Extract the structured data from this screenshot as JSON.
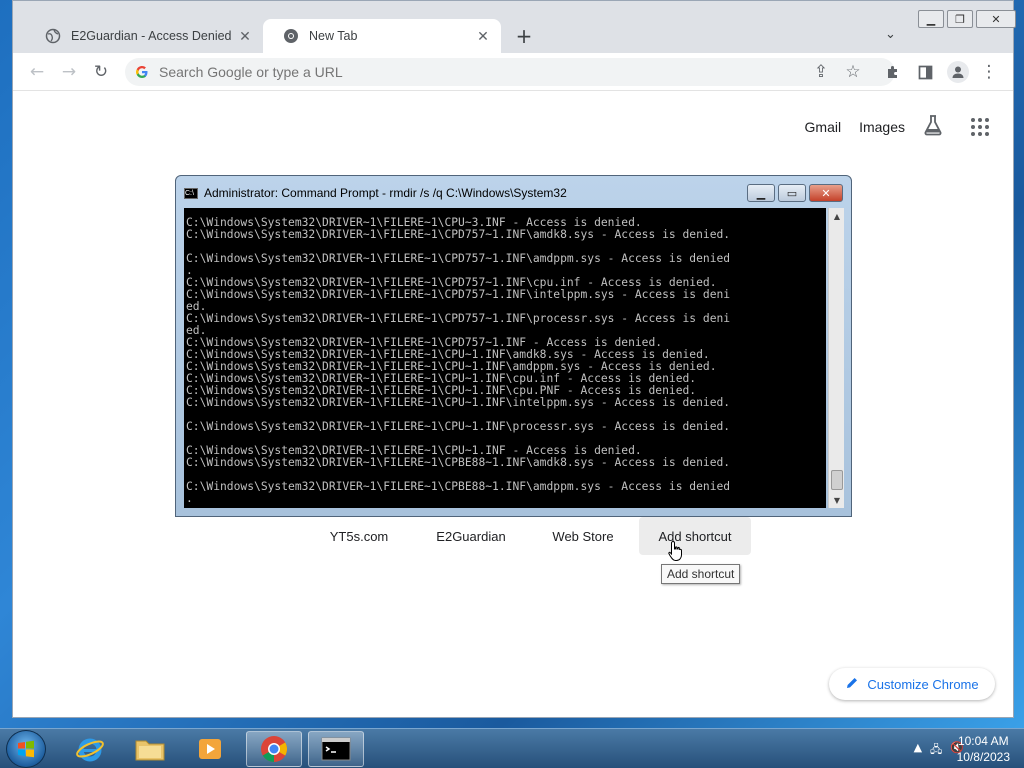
{
  "browser": {
    "tabs": [
      {
        "title": "E2Guardian - Access Denied",
        "active": false
      },
      {
        "title": "New Tab",
        "active": true
      }
    ],
    "omnibox_placeholder": "Search Google or type a URL"
  },
  "ntp": {
    "header_links": {
      "gmail": "Gmail",
      "images": "Images"
    },
    "shortcuts": [
      "YT5s.com",
      "E2Guardian",
      "Web Store",
      "Add shortcut"
    ],
    "tooltip": "Add shortcut",
    "customize_label": "Customize Chrome"
  },
  "cmd": {
    "title": "Administrator:  Command Prompt - rmdir  /s /q C:\\Windows\\System32",
    "lines": [
      "C:\\Windows\\System32\\DRIVER~1\\FILERE~1\\CPU~3.INF - Access is denied.",
      "C:\\Windows\\System32\\DRIVER~1\\FILERE~1\\CPD757~1.INF\\amdk8.sys - Access is denied.",
      "",
      "C:\\Windows\\System32\\DRIVER~1\\FILERE~1\\CPD757~1.INF\\amdppm.sys - Access is denied",
      ".",
      "C:\\Windows\\System32\\DRIVER~1\\FILERE~1\\CPD757~1.INF\\cpu.inf - Access is denied.",
      "C:\\Windows\\System32\\DRIVER~1\\FILERE~1\\CPD757~1.INF\\intelppm.sys - Access is deni",
      "ed.",
      "C:\\Windows\\System32\\DRIVER~1\\FILERE~1\\CPD757~1.INF\\processr.sys - Access is deni",
      "ed.",
      "C:\\Windows\\System32\\DRIVER~1\\FILERE~1\\CPD757~1.INF - Access is denied.",
      "C:\\Windows\\System32\\DRIVER~1\\FILERE~1\\CPU~1.INF\\amdk8.sys - Access is denied.",
      "C:\\Windows\\System32\\DRIVER~1\\FILERE~1\\CPU~1.INF\\amdppm.sys - Access is denied.",
      "C:\\Windows\\System32\\DRIVER~1\\FILERE~1\\CPU~1.INF\\cpu.inf - Access is denied.",
      "C:\\Windows\\System32\\DRIVER~1\\FILERE~1\\CPU~1.INF\\cpu.PNF - Access is denied.",
      "C:\\Windows\\System32\\DRIVER~1\\FILERE~1\\CPU~1.INF\\intelppm.sys - Access is denied.",
      "",
      "C:\\Windows\\System32\\DRIVER~1\\FILERE~1\\CPU~1.INF\\processr.sys - Access is denied.",
      "",
      "C:\\Windows\\System32\\DRIVER~1\\FILERE~1\\CPU~1.INF - Access is denied.",
      "C:\\Windows\\System32\\DRIVER~1\\FILERE~1\\CPBE88~1.INF\\amdk8.sys - Access is denied.",
      "",
      "C:\\Windows\\System32\\DRIVER~1\\FILERE~1\\CPBE88~1.INF\\amdppm.sys - Access is denied",
      "."
    ]
  },
  "taskbar": {
    "clock_time": "10:04 AM",
    "clock_date": "10/8/2023"
  },
  "colors": {
    "accent": "#1a73e8",
    "console_bg": "#000000",
    "console_fg": "#c0c0c0"
  }
}
